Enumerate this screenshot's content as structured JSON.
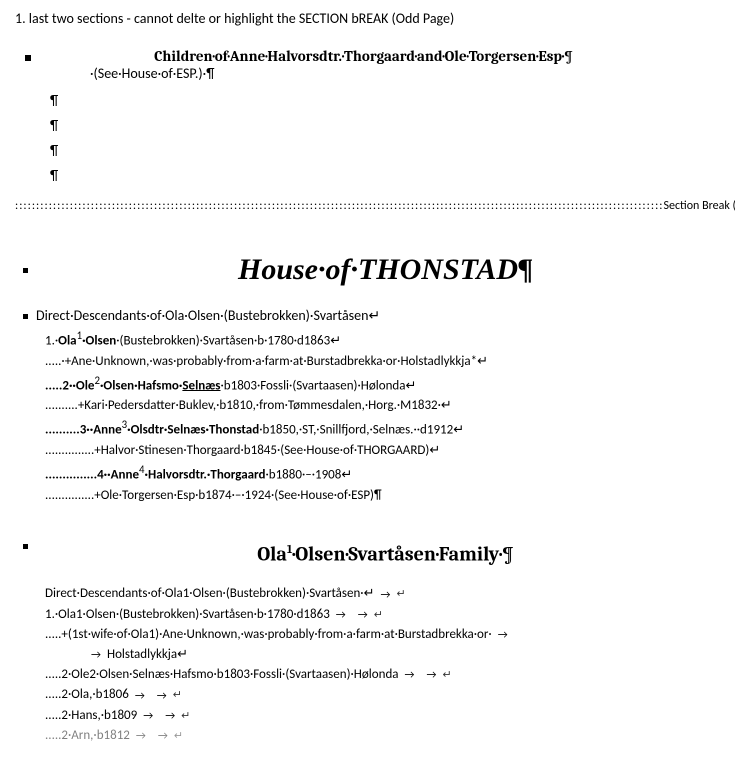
{
  "question": "1. last two sections - cannot delte or highlight the SECTION bREAK (Odd Page)",
  "children_heading": "Children·of·Anne·Halvorsdtr.·Thorgaard·and·Ole·Torgersen·Esp·¶",
  "see_house": "·(See·House·of·ESP.)·¶",
  "pilcrow": "¶",
  "section_break_label": "Section Break (Odd Page)",
  "house_title": "House·of·THONSTAD¶",
  "direct_desc1": "Direct·Descendants·of·Ola·Olsen·(Bustebrokken)·Svartåsen↵",
  "tree1": {
    "l1a": "1.·",
    "l1b": "Ola",
    "l1c": "·Olsen",
    "l1d": "·(Bustebrokken)·Svartåsen·b·1780·d1863↵",
    "l2": ".....·+Ane·Unknown,·was·probably·from·a·farm·at·Burstadbrekka·or·Holstadlykkja*↵",
    "l3a": ".....2··",
    "l3b": "Ole",
    "l3c": "·Olsen·Hafsmo·",
    "l3d": "Selnæs",
    "l3e": "·b1803·Fossli·(Svartaasen)·Hølonda↵",
    "l4": "..........+Kari·Pedersdatter·Buklev,·b1810,·from·Tømmesdalen,·Horg.·M1832·↵",
    "l5a": "..........3··",
    "l5b": "Anne",
    "l5c": "·Olsdtr·Selnæs·Thonstad",
    "l5d": "·b1850,·ST,·Snillfjord,·Selnæs.··d1912↵",
    "l6": "...............+Halvor·Stinesen·Thorgaard·b1845·(See·House·of·THORGAARD)↵",
    "l7a": "...............4··",
    "l7b": "Anne",
    "l7c": "·Halvorsdtr.·Thorgaard",
    "l7d": "·b1880·–·1908↵",
    "l8": "...............+Ole·Torgersen·Esp·b1874·–·1924·(See·House·of·ESP)¶"
  },
  "family_heading_a": "Ola",
  "family_heading_b": "·Olsen·Svartåsen·Family·¶",
  "direct_desc2": "Direct·Descendants·of·Ola1·Olsen·(Bustebrokken)·Svartåsen·↵",
  "tree2": {
    "l1": "1.·Ola1·Olsen·(Bustebrokken)·Svartåsen·b·1780·d1863",
    "l2a": ".....+(1st·wife·of·Ola1)·Ane·Unknown,·was·probably·from·a·farm·at·Burstadbrekka·or·",
    "l2b": "Holstadlykkja↵",
    "l3": ".....2·Ole2·Olsen·Selnæs·Hafsmo·b1803·Fossli·(Svartaasen)·Hølonda",
    "l4": ".....2·Ola,·b1806",
    "l5": ".....2·Hans,·b1809",
    "l6": ".....2·Arn,·b1812"
  },
  "sup1": "1",
  "sup2": "2",
  "sup3": "3",
  "sup4": "4"
}
